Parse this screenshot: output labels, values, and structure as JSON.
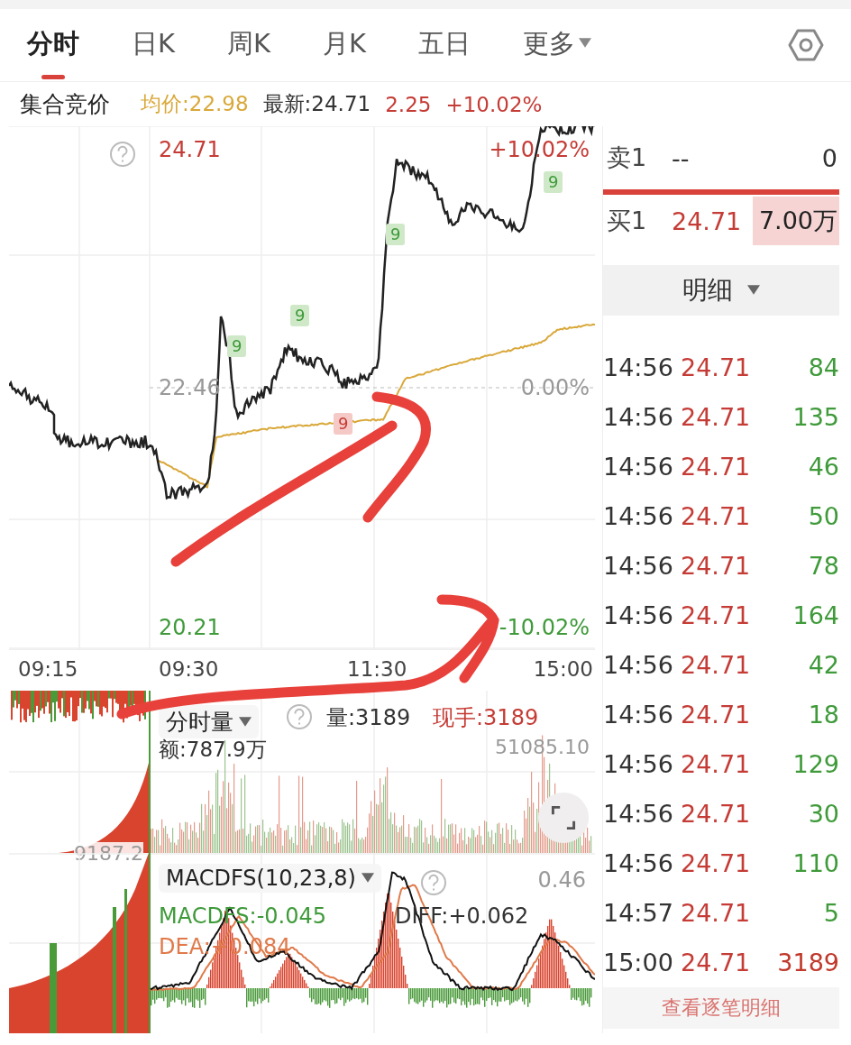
{
  "tabs": [
    {
      "label": "分时",
      "selected": true,
      "kind": "plain"
    },
    {
      "label": "日K",
      "selected": false,
      "kind": "plain"
    },
    {
      "label": "周K",
      "selected": false,
      "kind": "plain"
    },
    {
      "label": "月K",
      "selected": false,
      "kind": "plain"
    },
    {
      "label": "五日",
      "selected": false,
      "kind": "plain"
    },
    {
      "label": "更多",
      "selected": false,
      "kind": "dropdown"
    }
  ],
  "quote_bar": {
    "status": "集合竞价",
    "avg_price": "均价:22.98",
    "latest": "最新:24.71",
    "change": "2.25",
    "change_pct": "+10.02%"
  },
  "price_chart": {
    "high": "24.71",
    "mid": "22.46",
    "low": "20.21",
    "high_pct": "+10.02%",
    "mid_pct": "0.00%",
    "low_pct": "-10.02%",
    "markers": [
      {
        "label": "9",
        "kind": "up"
      },
      {
        "label": "9",
        "kind": "up"
      },
      {
        "label": "9",
        "kind": "down"
      },
      {
        "label": "9",
        "kind": "up"
      },
      {
        "label": "9",
        "kind": "up"
      }
    ]
  },
  "time_axis": [
    "09:15",
    "09:30",
    "11:30",
    "15:00"
  ],
  "volume_panel": {
    "selector": "分时量",
    "volume": "量:3189",
    "current": "现手:3189",
    "amount": "额:787.9万",
    "auction_max": "9187.2",
    "max": "51085.10"
  },
  "macd_panel": {
    "selector": "MACDFS(10,23,8)",
    "max": "0.46",
    "macdfs": "MACDFS:-0.045",
    "diff": "DIFF:+0.062",
    "dea": "DEA:+0.084"
  },
  "order_book": {
    "ask": {
      "label": "卖1",
      "price": "--",
      "volume": "0"
    },
    "bid": {
      "label": "买1",
      "price": "24.71",
      "volume": "7.00万"
    }
  },
  "detail_button": "明细",
  "trades": [
    {
      "time": "14:56",
      "price": "24.71",
      "volume": "84",
      "color": "#3f9a3a"
    },
    {
      "time": "14:56",
      "price": "24.71",
      "volume": "135",
      "color": "#3f9a3a"
    },
    {
      "time": "14:56",
      "price": "24.71",
      "volume": "46",
      "color": "#3f9a3a"
    },
    {
      "time": "14:56",
      "price": "24.71",
      "volume": "50",
      "color": "#3f9a3a"
    },
    {
      "time": "14:56",
      "price": "24.71",
      "volume": "78",
      "color": "#3f9a3a"
    },
    {
      "time": "14:56",
      "price": "24.71",
      "volume": "164",
      "color": "#3f9a3a"
    },
    {
      "time": "14:56",
      "price": "24.71",
      "volume": "42",
      "color": "#3f9a3a"
    },
    {
      "time": "14:56",
      "price": "24.71",
      "volume": "18",
      "color": "#3f9a3a"
    },
    {
      "time": "14:56",
      "price": "24.71",
      "volume": "129",
      "color": "#3f9a3a"
    },
    {
      "time": "14:56",
      "price": "24.71",
      "volume": "30",
      "color": "#3f9a3a"
    },
    {
      "time": "14:56",
      "price": "24.71",
      "volume": "110",
      "color": "#3f9a3a"
    },
    {
      "time": "14:57",
      "price": "24.71",
      "volume": "5",
      "color": "#3f9a3a"
    },
    {
      "time": "15:00",
      "price": "24.71",
      "volume": "3189",
      "color": "#c0392b"
    }
  ],
  "all_trades_button": "查看逐笔明细"
}
